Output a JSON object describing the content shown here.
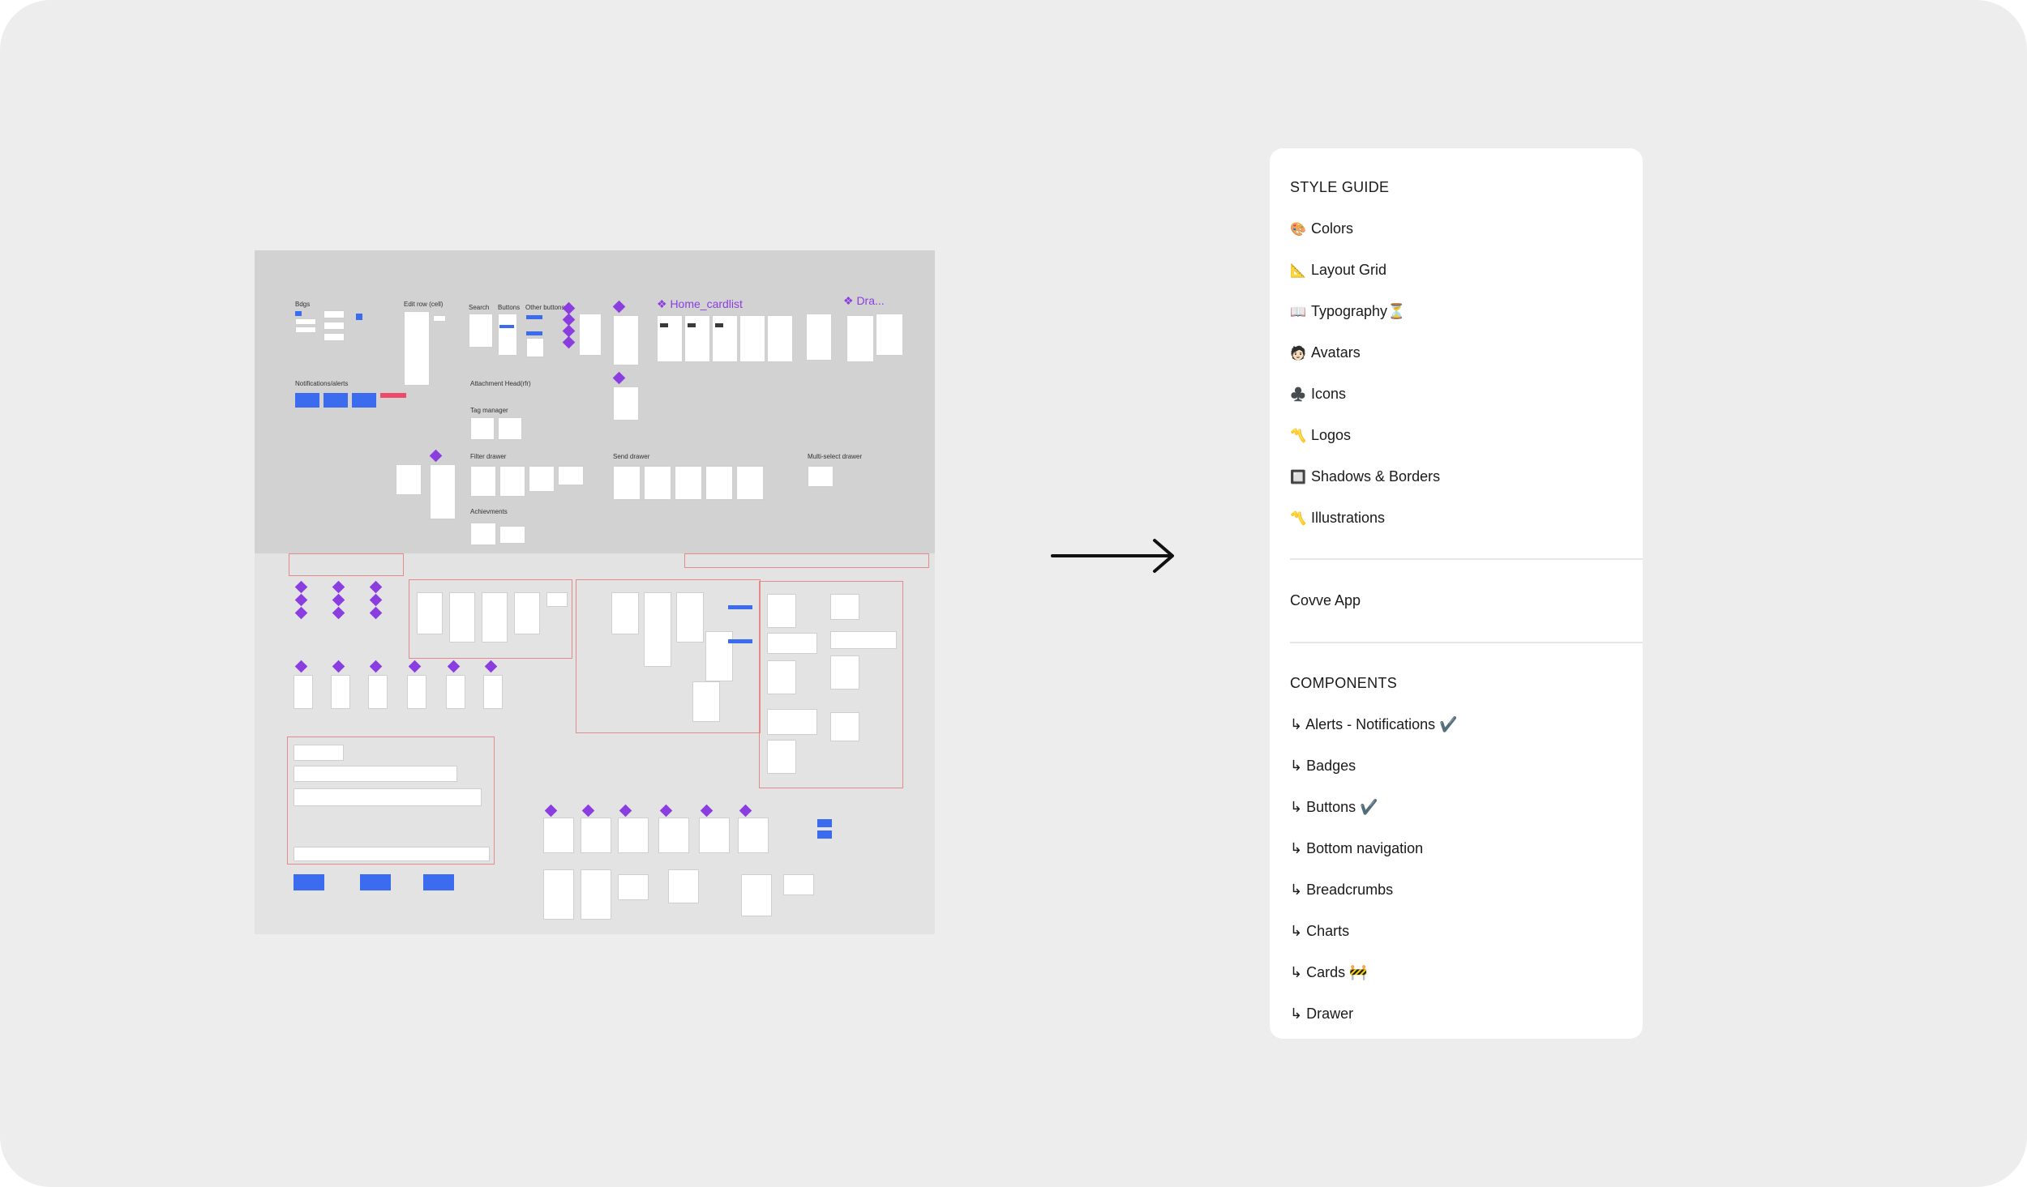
{
  "canvas": {
    "labels": {
      "home_cardlist": "❖ Home_cardlist",
      "drawer": "❖ Dra..."
    }
  },
  "panel": {
    "style_guide": {
      "title": "STYLE GUIDE",
      "items": [
        {
          "icon": "🎨",
          "label": "Colors"
        },
        {
          "icon": "📐",
          "label": "Layout Grid"
        },
        {
          "icon": "📖",
          "label": "Typography⏳"
        },
        {
          "icon": "🧑🏻",
          "label": "Avatars"
        },
        {
          "icon": "♣️",
          "label": "Icons"
        },
        {
          "icon": "〽️",
          "label": "Logos"
        },
        {
          "icon": "🔲",
          "label": "Shadows & Borders"
        },
        {
          "icon": "〽️",
          "label": "Illustrations"
        }
      ]
    },
    "app_page": "Covve App",
    "components": {
      "title": "COMPONENTS",
      "items": [
        "↳  Alerts - Notifications ✔️",
        "↳  Badges",
        "↳ Buttons ✔️",
        "↳ Bottom navigation",
        "↳ Breadcrumbs",
        "↳ Charts",
        "↳ Cards 🚧",
        "↳ Drawer"
      ]
    }
  },
  "colors": {
    "background": "#ededed",
    "canvas_top": "#d2d2d2",
    "canvas_bottom": "#e3e3e3",
    "component_purple": "#8b3ee0",
    "accent_blue": "#3b6cf0"
  }
}
